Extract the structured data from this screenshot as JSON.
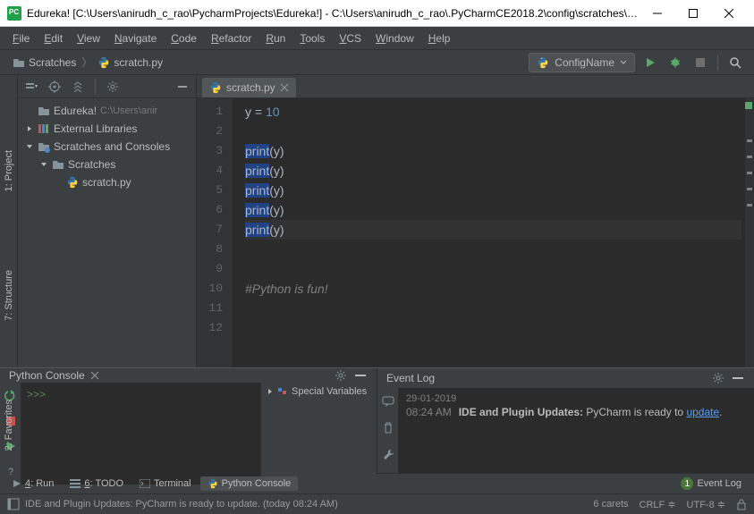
{
  "titlebar": {
    "text": "Edureka! [C:\\Users\\anirudh_c_rao\\PycharmProjects\\Edureka!] - C:\\Users\\anirudh_c_rao\\.PyCharmCE2018.2\\config\\scratches\\s..."
  },
  "menubar": {
    "items": [
      "File",
      "Edit",
      "View",
      "Navigate",
      "Code",
      "Refactor",
      "Run",
      "Tools",
      "VCS",
      "Window",
      "Help"
    ]
  },
  "breadcrumbs": {
    "items": [
      {
        "icon": "folder",
        "label": "Scratches"
      },
      {
        "icon": "python",
        "label": "scratch.py"
      }
    ]
  },
  "runconfig": {
    "label": "ConfigName"
  },
  "project_tree": {
    "rows": [
      {
        "indent": 0,
        "arrow": "",
        "icon": "folder",
        "label": "Edureka!",
        "path": "C:\\Users\\anir"
      },
      {
        "indent": 0,
        "arrow": "right",
        "icon": "lib",
        "label": "External Libraries",
        "path": ""
      },
      {
        "indent": 0,
        "arrow": "down",
        "icon": "scratch",
        "label": "Scratches and Consoles",
        "path": ""
      },
      {
        "indent": 1,
        "arrow": "down",
        "icon": "folder",
        "label": "Scratches",
        "path": ""
      },
      {
        "indent": 2,
        "arrow": "",
        "icon": "python",
        "label": "scratch.py",
        "path": ""
      }
    ]
  },
  "editor": {
    "tab": {
      "label": "scratch.py"
    },
    "lines": [
      {
        "n": 1,
        "segments": [
          {
            "t": "y ",
            "c": "str"
          },
          {
            "t": "= ",
            "c": "str"
          },
          {
            "t": "10",
            "c": "num"
          }
        ]
      },
      {
        "n": 2,
        "segments": []
      },
      {
        "n": 3,
        "segments": [
          {
            "t": "print",
            "c": "fn",
            "sel": true
          },
          {
            "t": "(y)",
            "c": "str"
          }
        ]
      },
      {
        "n": 4,
        "segments": [
          {
            "t": "print",
            "c": "fn",
            "sel": true
          },
          {
            "t": "(y)",
            "c": "str"
          }
        ]
      },
      {
        "n": 5,
        "segments": [
          {
            "t": "print",
            "c": "fn",
            "sel": true
          },
          {
            "t": "(y)",
            "c": "str"
          }
        ]
      },
      {
        "n": 6,
        "segments": [
          {
            "t": "print",
            "c": "fn",
            "sel": true
          },
          {
            "t": "(y)",
            "c": "str"
          }
        ]
      },
      {
        "n": 7,
        "segments": [
          {
            "t": "print",
            "c": "fn",
            "sel": true
          },
          {
            "t": "(y)",
            "c": "str"
          }
        ]
      },
      {
        "n": 8,
        "segments": []
      },
      {
        "n": 9,
        "segments": []
      },
      {
        "n": 10,
        "segments": [
          {
            "t": "#Python is fun!",
            "c": "comment"
          }
        ]
      },
      {
        "n": 11,
        "segments": []
      },
      {
        "n": 12,
        "segments": []
      }
    ]
  },
  "left_gutter": {
    "tabs": [
      "1: Project",
      "7: Structure",
      "2: Favorites"
    ]
  },
  "bottom_panels": {
    "console": {
      "title": "Python Console",
      "prompt": ">>>",
      "special_vars": "Special Variables"
    },
    "eventlog": {
      "title": "Event Log",
      "date": "29-01-2019",
      "time": "08:24 AM",
      "msg_bold": "IDE and Plugin Updates:",
      "msg_text": "PyCharm is ready to",
      "msg_link": "update"
    }
  },
  "tool_windows": {
    "items": [
      {
        "label": "4: Run",
        "u": "4"
      },
      {
        "label": "6: TODO",
        "u": "6"
      },
      {
        "label": "Terminal"
      },
      {
        "label": "Python Console",
        "active": true
      }
    ],
    "right": {
      "badge": "1",
      "label": "Event Log"
    }
  },
  "statusbar": {
    "msg": "IDE and Plugin Updates: PyCharm is ready to update. (today 08:24 AM)",
    "carets": "6 carets",
    "eol": "CRLF",
    "enc": "UTF-8"
  }
}
